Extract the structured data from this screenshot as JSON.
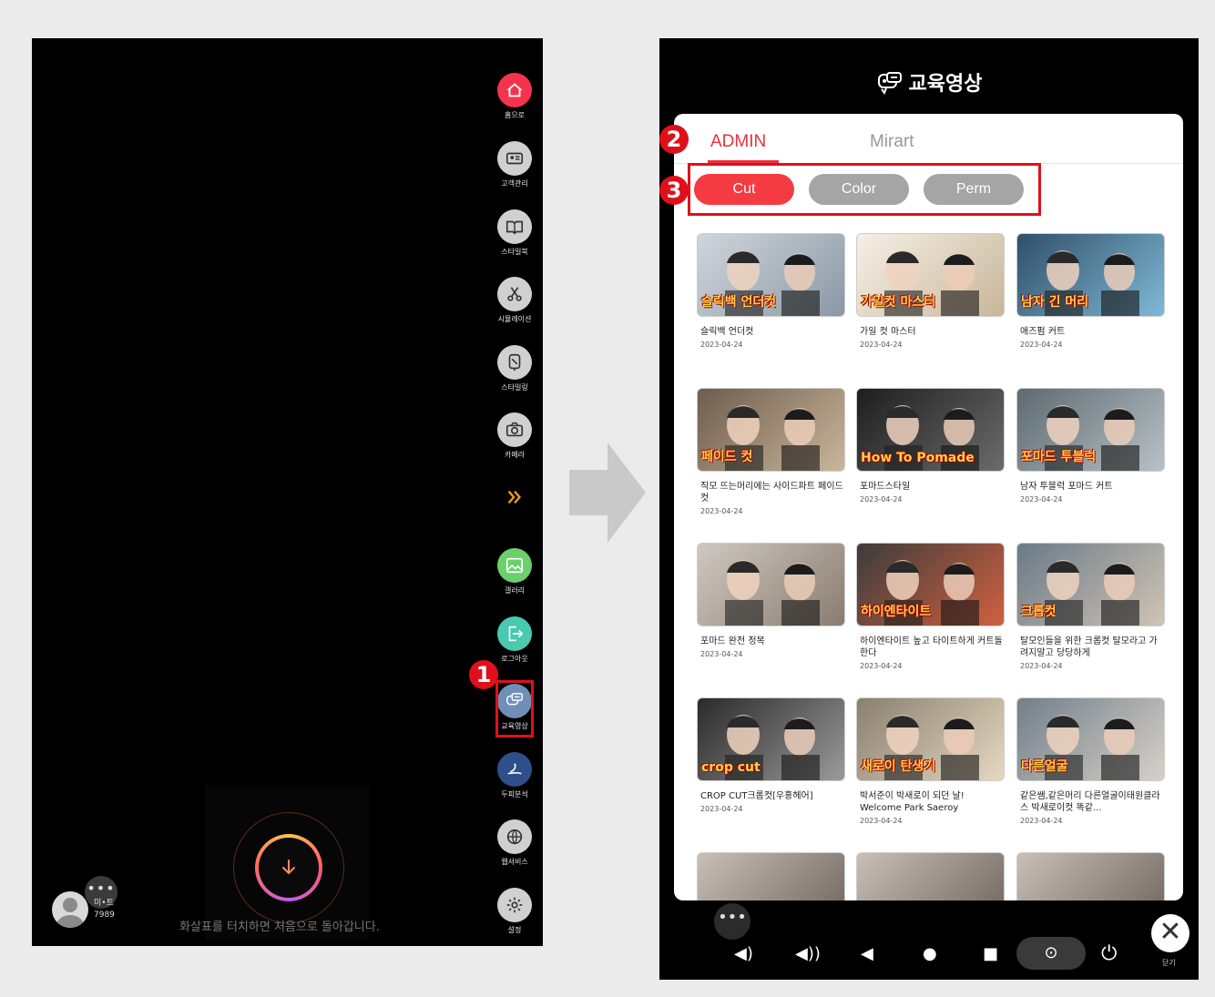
{
  "left_screen": {
    "menu": [
      {
        "label": "홈으로",
        "color": "#f5334f",
        "icon": "home-icon"
      },
      {
        "label": "고객관리",
        "color": "#d0d0d0",
        "icon": "id-card-icon"
      },
      {
        "label": "스타일북",
        "color": "#d0d0d0",
        "icon": "book-icon"
      },
      {
        "label": "시뮬레이션",
        "color": "#d0d0d0",
        "icon": "scissors-icon"
      },
      {
        "label": "스타일링",
        "color": "#d0d0d0",
        "icon": "mirror-icon"
      },
      {
        "label": "카메라",
        "color": "#d0d0d0",
        "icon": "camera-icon"
      },
      {
        "label": "",
        "color": "",
        "icon": "double-chevron-icon"
      },
      {
        "label": "갤러리",
        "color": "#6ad06b",
        "icon": "gallery-icon"
      },
      {
        "label": "로그아웃",
        "color": "#48c9b0",
        "icon": "logout-icon"
      },
      {
        "label": "교육영상",
        "color": "#6f8fb8",
        "icon": "video-chat-icon"
      },
      {
        "label": "두피분석",
        "color": "#2e4f8a",
        "icon": "scalp-icon"
      },
      {
        "label": "웹서비스",
        "color": "#d0d0d0",
        "icon": "globe-icon"
      },
      {
        "label": "설정",
        "color": "#d0d0d0",
        "icon": "gear-icon"
      }
    ],
    "hint": "화살표를 터치하면 처음으로 돌아갑니다.",
    "user": {
      "name": "미•트",
      "count": "7989",
      "dots": "•••"
    }
  },
  "annotations": {
    "one": "1",
    "two": "2",
    "three": "3"
  },
  "right_screen": {
    "title": "교육영상",
    "tabs": {
      "admin": "ADMIN",
      "mirart": "Mirart"
    },
    "chips": [
      {
        "label": "Cut",
        "color": "#f43b42"
      },
      {
        "label": "Color",
        "color": "#a5a5a5"
      },
      {
        "label": "Perm",
        "color": "#a5a5a5"
      }
    ],
    "videos": [
      {
        "title": "슬릭백 언더컷",
        "date": "2023-04-24",
        "overlay": "슬릭백 언더컷"
      },
      {
        "title": "가일 컷 마스터",
        "date": "2023-04-24",
        "overlay": "가일컷 마스터"
      },
      {
        "title": "애즈펌 커트",
        "date": "2023-04-24",
        "overlay": "남자 긴 머리"
      },
      {
        "title": "직모 뜨는머리에는 사이드파트 페이드컷",
        "date": "2023-04-24",
        "overlay": "페이드 컷"
      },
      {
        "title": "포마드스타일",
        "date": "2023-04-24",
        "overlay": "How To Pomade"
      },
      {
        "title": "남자 투블럭 포마드 커트",
        "date": "2023-04-24",
        "overlay": "포마드 투블럭"
      },
      {
        "title": "포마드 완전 정복",
        "date": "2023-04-24",
        "overlay": ""
      },
      {
        "title": "하이엔타이트 높고 타이트하게 커트돌한다",
        "date": "2023-04-24",
        "overlay": "하이엔타이트"
      },
      {
        "title": "탈모인들을 위한 크롭컷 탈모라고 가려지말고 당당하게",
        "date": "2023-04-24",
        "overlay": "크롭컷"
      },
      {
        "title": "CROP CUT크롭컷[우홍헤어]",
        "date": "2023-04-24",
        "overlay": "crop cut"
      },
      {
        "title": "박서준이 박새로이 되던 날! Welcome Park Saeroy",
        "date": "2023-04-24",
        "overlay": "새로이 탄생기"
      },
      {
        "title": "같은쌤,같은머리 다른얼굴이태원클라스 박새로이컷 똑같...",
        "date": "2023-04-24",
        "overlay": "다른얼굴"
      }
    ],
    "close_label": "닫기",
    "nav": {
      "dots": "•••"
    }
  }
}
